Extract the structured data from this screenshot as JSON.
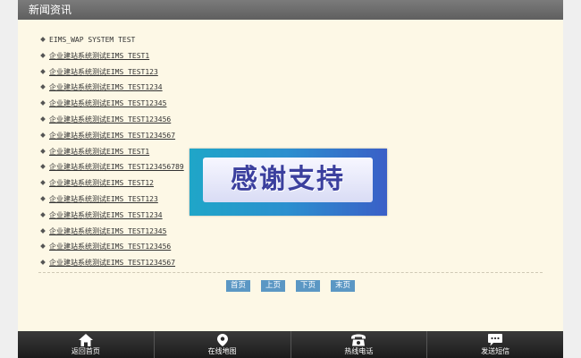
{
  "header": {
    "title": "新闻资讯"
  },
  "news": [
    {
      "text": "EIMS_WAP SYSTEM TEST",
      "linked": false
    },
    {
      "text": "企业建站系统测试EIMS TEST1",
      "linked": true
    },
    {
      "text": "企业建站系统测试EIMS TEST123",
      "linked": true
    },
    {
      "text": "企业建站系统测试EIMS TEST1234",
      "linked": true
    },
    {
      "text": "企业建站系统测试EIMS TEST12345",
      "linked": true
    },
    {
      "text": "企业建站系统测试EIMS TEST123456",
      "linked": true
    },
    {
      "text": "企业建站系统测试EIMS TEST1234567",
      "linked": true
    },
    {
      "text": "企业建站系统测试EIMS TEST1",
      "linked": true
    },
    {
      "text": "企业建站系统测试EIMS TEST123456789",
      "linked": true
    },
    {
      "text": "企业建站系统测试EIMS TEST12",
      "linked": true
    },
    {
      "text": "企业建站系统测试EIMS TEST123",
      "linked": true
    },
    {
      "text": "企业建站系统测试EIMS TEST1234",
      "linked": true
    },
    {
      "text": "企业建站系统测试EIMS TEST12345",
      "linked": true
    },
    {
      "text": "企业建站系统测试EIMS TEST123456",
      "linked": true
    },
    {
      "text": "企业建站系统测试EIMS TEST1234567",
      "linked": true
    }
  ],
  "pager": {
    "first": "首页",
    "prev": "上页",
    "next": "下页",
    "last": "末页"
  },
  "banner": {
    "text": "感谢支持"
  },
  "footer": {
    "home": "返回首页",
    "map": "在线地图",
    "phone": "热线电话",
    "sms": "发送短信"
  },
  "colors": {
    "header_bg": "#6b6b6b",
    "page_bg": "#fdf8e6",
    "pager_button": "#5b97c4",
    "footer_bg": "#2a2a2a",
    "banner_text": "#3b3f9e"
  },
  "icons": {
    "home": "home-icon",
    "map": "map-pin-icon",
    "phone": "phone-icon",
    "sms": "chat-bubble-icon"
  }
}
